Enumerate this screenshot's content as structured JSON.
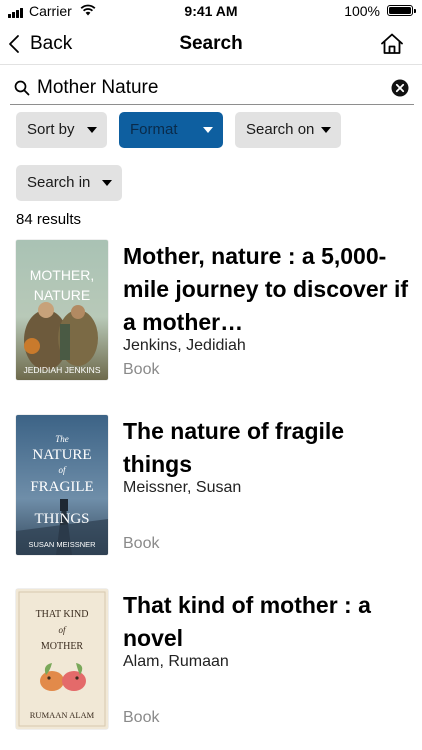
{
  "status_bar": {
    "carrier": "Carrier",
    "time": "9:41 AM",
    "battery": "100%"
  },
  "nav": {
    "back_label": "Back",
    "title": "Search"
  },
  "search": {
    "value": "Mother Nature"
  },
  "filters": [
    {
      "label": "Sort by",
      "active": false
    },
    {
      "label": "Format",
      "active": true
    },
    {
      "label": "Search on",
      "active": false
    },
    {
      "label": "Search in",
      "active": false
    }
  ],
  "results_count": "84 results",
  "results": [
    {
      "title": "Mother, nature : a 5,000-mile journey to discover if a mother…",
      "author": "Jenkins, Jedidiah",
      "format": "Book",
      "cover": {
        "line1": "MOTHER,",
        "line2": "NATURE",
        "author": "JEDIDIAH JENKINS"
      }
    },
    {
      "title": "The nature of fragile things",
      "author": "Meissner, Susan",
      "format": "Book",
      "cover": {
        "line1": "The",
        "line2": "NATURE",
        "line3": "of",
        "line4": "FRAGILE",
        "line5": "THINGS",
        "author": "SUSAN MEISSNER"
      }
    },
    {
      "title": "That kind of mother : a novel",
      "author": "Alam, Rumaan",
      "format": "Book",
      "cover": {
        "line1": "THAT KIND",
        "line2": "of",
        "line3": "MOTHER",
        "author": "RUMAAN ALAM"
      }
    }
  ],
  "colors": {
    "accent": "#0e5fa0",
    "chip": "#e2e2e2",
    "muted": "#8a8a8a"
  },
  "icons": [
    "cellular-signal-icon",
    "wifi-icon",
    "battery-icon",
    "chevron-left-icon",
    "home-icon",
    "search-icon",
    "clear-icon",
    "caret-down-icon"
  ]
}
